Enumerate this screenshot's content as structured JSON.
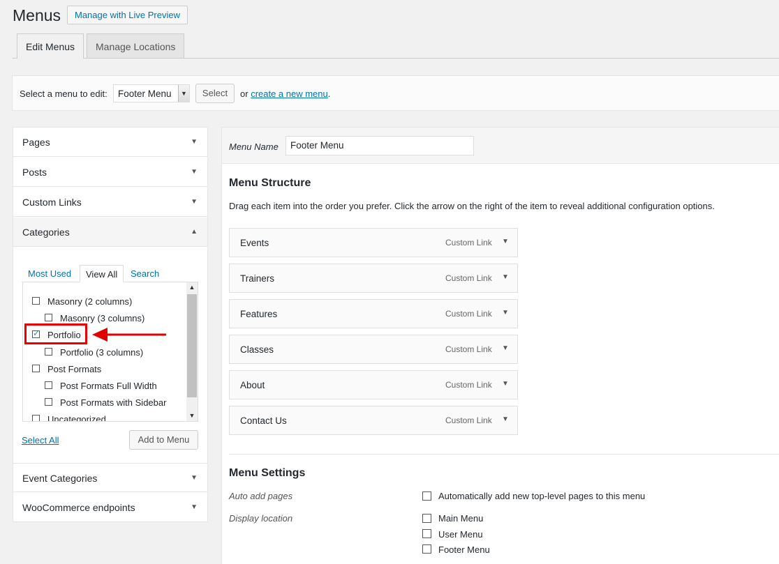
{
  "page": {
    "title": "Menus",
    "live_preview_label": "Manage with Live Preview"
  },
  "tabs": [
    {
      "label": "Edit Menus",
      "active": true
    },
    {
      "label": "Manage Locations",
      "active": false
    }
  ],
  "manage": {
    "select_label": "Select a menu to edit:",
    "selected_menu": "Footer Menu",
    "select_button": "Select",
    "or_text": "or",
    "create_link": "create a new menu",
    "period": "."
  },
  "accordion": {
    "sections": [
      {
        "label": "Pages",
        "open": false
      },
      {
        "label": "Posts",
        "open": false
      },
      {
        "label": "Custom Links",
        "open": false
      },
      {
        "label": "Categories",
        "open": true
      },
      {
        "label": "Event Categories",
        "open": false
      },
      {
        "label": "WooCommerce endpoints",
        "open": false
      }
    ],
    "category_tabs": [
      "Most Used",
      "View All",
      "Search"
    ],
    "active_category_tab": "View All",
    "categories": [
      {
        "label": "Masonry (2 columns)",
        "checked": false,
        "indent": 0
      },
      {
        "label": "Masonry (3 columns)",
        "checked": false,
        "indent": 1
      },
      {
        "label": "Portfolio",
        "checked": true,
        "indent": 0
      },
      {
        "label": "Portfolio (3 columns)",
        "checked": false,
        "indent": 1
      },
      {
        "label": "Post Formats",
        "checked": false,
        "indent": 0
      },
      {
        "label": "Post Formats Full Width",
        "checked": false,
        "indent": 1
      },
      {
        "label": "Post Formats with Sidebar",
        "checked": false,
        "indent": 1
      },
      {
        "label": "Uncategorized",
        "checked": false,
        "indent": 0
      }
    ],
    "select_all": "Select All",
    "add_to_menu": "Add to Menu"
  },
  "editor": {
    "menu_name_label": "Menu Name",
    "menu_name_value": "Footer Menu",
    "structure_title": "Menu Structure",
    "structure_desc": "Drag each item into the order you prefer. Click the arrow on the right of the item to reveal additional configuration options.",
    "items": [
      {
        "title": "Events",
        "type": "Custom Link"
      },
      {
        "title": "Trainers",
        "type": "Custom Link"
      },
      {
        "title": "Features",
        "type": "Custom Link"
      },
      {
        "title": "Classes",
        "type": "Custom Link"
      },
      {
        "title": "About",
        "type": "Custom Link"
      },
      {
        "title": "Contact Us",
        "type": "Custom Link"
      }
    ],
    "settings_title": "Menu Settings",
    "auto_add_label": "Auto add pages",
    "auto_add_option": "Automatically add new top-level pages to this menu",
    "display_location_label": "Display location",
    "locations": [
      "Main Menu",
      "User Menu",
      "Footer Menu"
    ]
  },
  "colors": {
    "link": "#0073aa",
    "annotation": "#e00000"
  }
}
